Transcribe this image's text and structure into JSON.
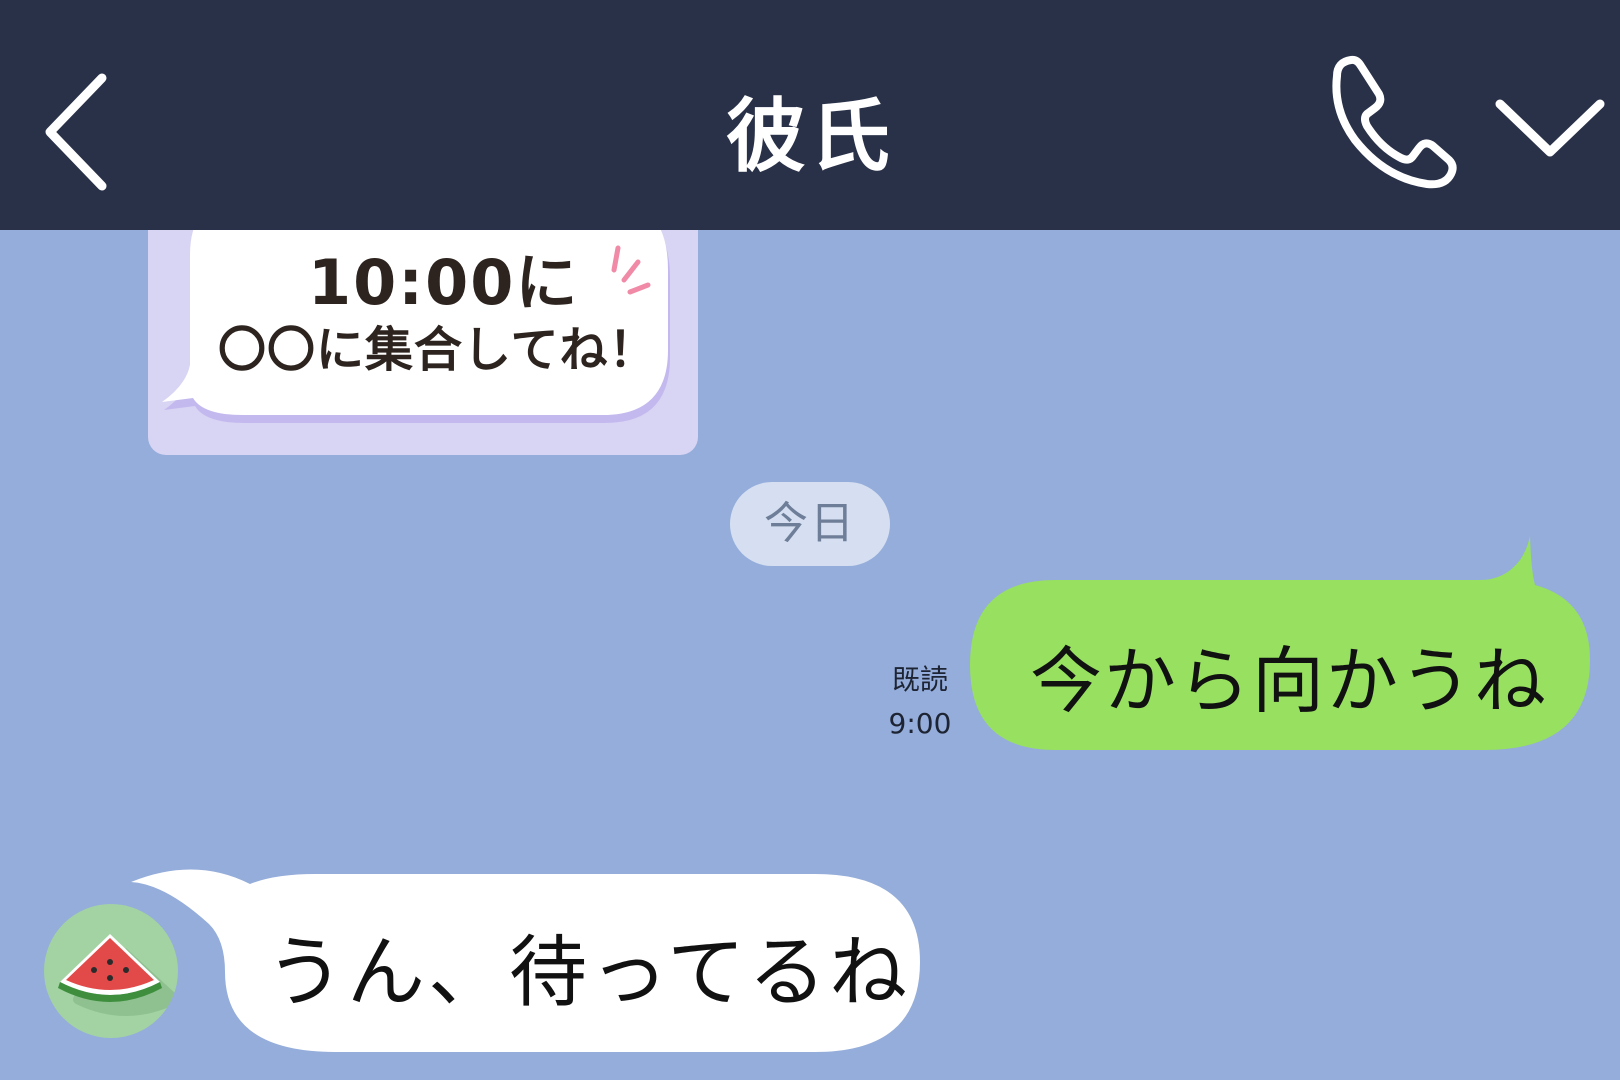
{
  "header": {
    "title": "彼氏",
    "back_icon": "chevron-left-icon",
    "call_icon": "phone-icon",
    "menu_icon": "chevron-down-icon"
  },
  "sticker": {
    "line1": "10:00に",
    "line2": "〇〇に集合してね！"
  },
  "date_separator": "今日",
  "outgoing_message": {
    "text": "今から向かうね",
    "read_label": "既読",
    "time": "9:00"
  },
  "incoming_message": {
    "text": "うん、待ってるね",
    "avatar_icon": "watermelon-icon"
  },
  "colors": {
    "header_bg": "#293148",
    "chat_bg": "#95adda",
    "outgoing_bubble": "#97e060",
    "incoming_bubble": "#ffffff",
    "sticker_bg": "#d8d4f3"
  }
}
